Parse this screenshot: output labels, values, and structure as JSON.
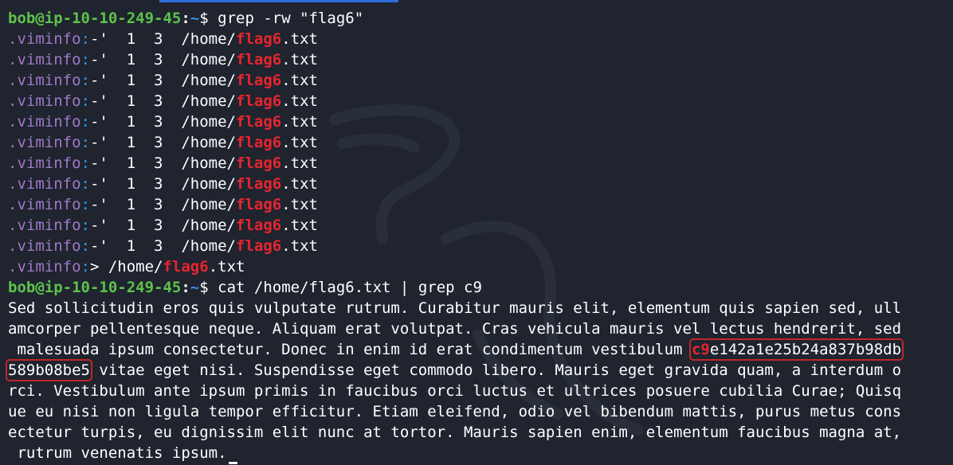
{
  "prompt": {
    "user_host": "bob@ip-10-10-249-45",
    "colon": ":",
    "path": "~",
    "dollar": "$"
  },
  "commands": {
    "first": "grep -rw \"flag6\"",
    "second": "cat /home/flag6.txt | grep c9"
  },
  "grep_results": {
    "viminfo_file": ".viminfo",
    "separator": ":",
    "entry_rest": "-'  1  3  /home/",
    "match": "flag6",
    "suffix": ".txt",
    "last_rest": "> /home/"
  },
  "paragraph": {
    "line1": "Sed sollicitudin eros quis vulputate rutrum. Curabitur mauris elit, elementum quis sapien sed, ull",
    "line2": "amcorper pellentesque neque. Aliquam erat volutpat. Cras vehicula mauris vel lectus hendrerit, sed",
    "line3_pre": " malesuada ipsum consectetur. Donec in enim id erat condimentum vestibulum ",
    "line3_match": "c9",
    "line3_hash": "e142a1e25b24a837b98db",
    "line4_hash": "589b08be5",
    "line4_post": " vitae eget nisi. Suspendisse eget commodo libero. Mauris eget gravida quam, a interdum o",
    "line5": "rci. Vestibulum ante ipsum primis in faucibus orci luctus et ultrices posuere cubilia Curae; Quisq",
    "line6": "ue eu nisi non ligula tempor efficitur. Etiam eleifend, odio vel bibendum mattis, purus metus cons",
    "line7": "ectetur turpis, eu dignissim elit nunc at tortor. Mauris sapien enim, elementum faucibus magna at,",
    "line8": " rutrum venenatis ipsum."
  },
  "colors": {
    "background": "#1f242f",
    "prompt_user": "#5ec24a",
    "prompt_path": "#3a8ee6",
    "filename": "#a178c8",
    "match": "#e8252e",
    "highlight_box": "#c2262b"
  }
}
